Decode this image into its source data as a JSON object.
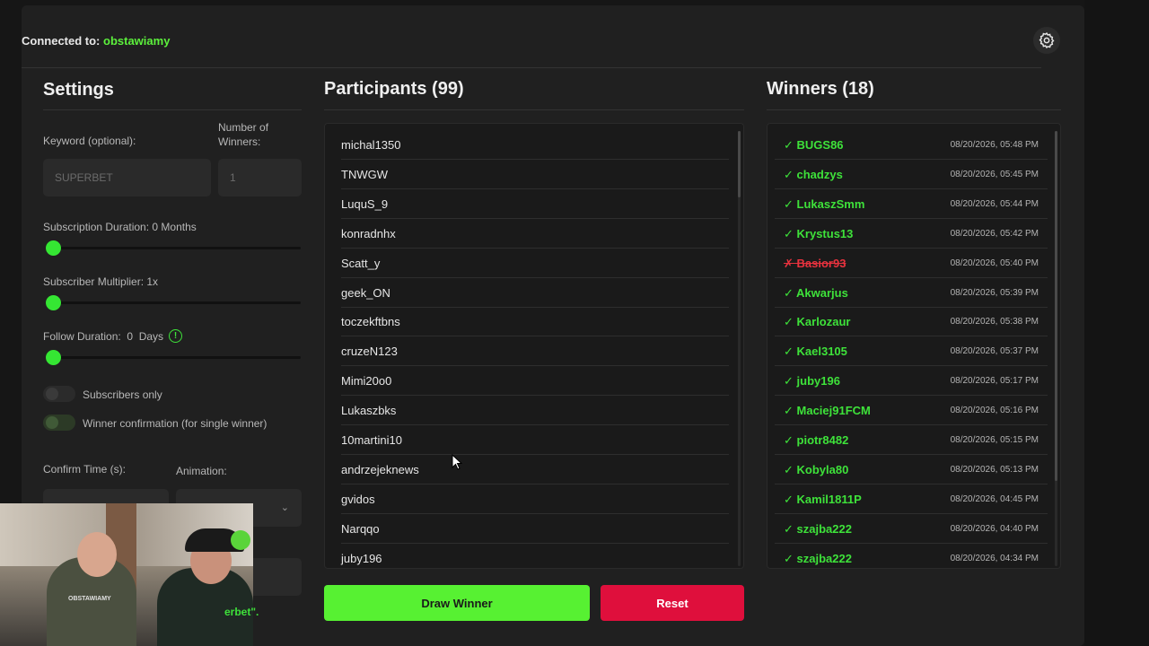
{
  "header": {
    "connected_prefix": "Connected to:",
    "channel": "obstawiamy"
  },
  "settings": {
    "title": "Settings",
    "keyword_label": "Keyword (optional):",
    "keyword_placeholder": "SUPERBET",
    "winners_label": "Number of Winners:",
    "winners_placeholder": "1",
    "sub_duration_label": "Subscription Duration: 0 Months",
    "sub_duration_value": 0,
    "sub_multiplier_label": "Subscriber Multiplier: 1x",
    "sub_multiplier_value": 1,
    "follow_label": "Follow Duration:  0  Days",
    "follow_value": 0,
    "subscribers_only_label": "Subscribers only",
    "subscribers_only": false,
    "confirmation_label": "Winner confirmation (for single winner)",
    "confirmation": true,
    "confirm_time_label": "Confirm Time (s):",
    "animation_label": "Animation:",
    "partial_message": "erbet\"."
  },
  "participants": {
    "title": "Participants (99)",
    "items": [
      "michal1350",
      "TNWGW",
      "LuquS_9",
      "konradnhx",
      "Scatt_y",
      "geek_ON",
      "toczekftbns",
      "cruzeN123",
      "Mimi20o0",
      "Lukaszbks",
      "10martini10",
      "andrzejeknews",
      "gvidos",
      "Narqqo",
      "juby196"
    ]
  },
  "winners": {
    "title": "Winners (18)",
    "items": [
      {
        "name": "BUGS86",
        "date": "08/20/2026, 05:48 PM",
        "ok": true
      },
      {
        "name": "chadzys",
        "date": "08/20/2026, 05:45 PM",
        "ok": true
      },
      {
        "name": "LukaszSmm",
        "date": "08/20/2026, 05:44 PM",
        "ok": true
      },
      {
        "name": "Krystus13",
        "date": "08/20/2026, 05:42 PM",
        "ok": true
      },
      {
        "name": "Basior93",
        "date": "08/20/2026, 05:40 PM",
        "ok": false
      },
      {
        "name": "Akwarjus",
        "date": "08/20/2026, 05:39 PM",
        "ok": true
      },
      {
        "name": "Karlozaur",
        "date": "08/20/2026, 05:38 PM",
        "ok": true
      },
      {
        "name": "Kael3105",
        "date": "08/20/2026, 05:37 PM",
        "ok": true
      },
      {
        "name": "juby196",
        "date": "08/20/2026, 05:17 PM",
        "ok": true
      },
      {
        "name": "Maciej91FCM",
        "date": "08/20/2026, 05:16 PM",
        "ok": true
      },
      {
        "name": "piotr8482",
        "date": "08/20/2026, 05:15 PM",
        "ok": true
      },
      {
        "name": "Kobyla80",
        "date": "08/20/2026, 05:13 PM",
        "ok": true
      },
      {
        "name": "Kamil1811P",
        "date": "08/20/2026, 04:45 PM",
        "ok": true
      },
      {
        "name": "szajba222",
        "date": "08/20/2026, 04:40 PM",
        "ok": true
      },
      {
        "name": "szajba222",
        "date": "08/20/2026, 04:34 PM",
        "ok": true
      }
    ]
  },
  "buttons": {
    "draw": "Draw Winner",
    "reset": "Reset"
  },
  "webcam": {
    "shirt_text": "OBSTAWIAMY"
  },
  "colors": {
    "accent": "#57f132",
    "winner_ok": "#3ee23a",
    "winner_bad": "#e8323e",
    "reset": "#df0f3c"
  }
}
